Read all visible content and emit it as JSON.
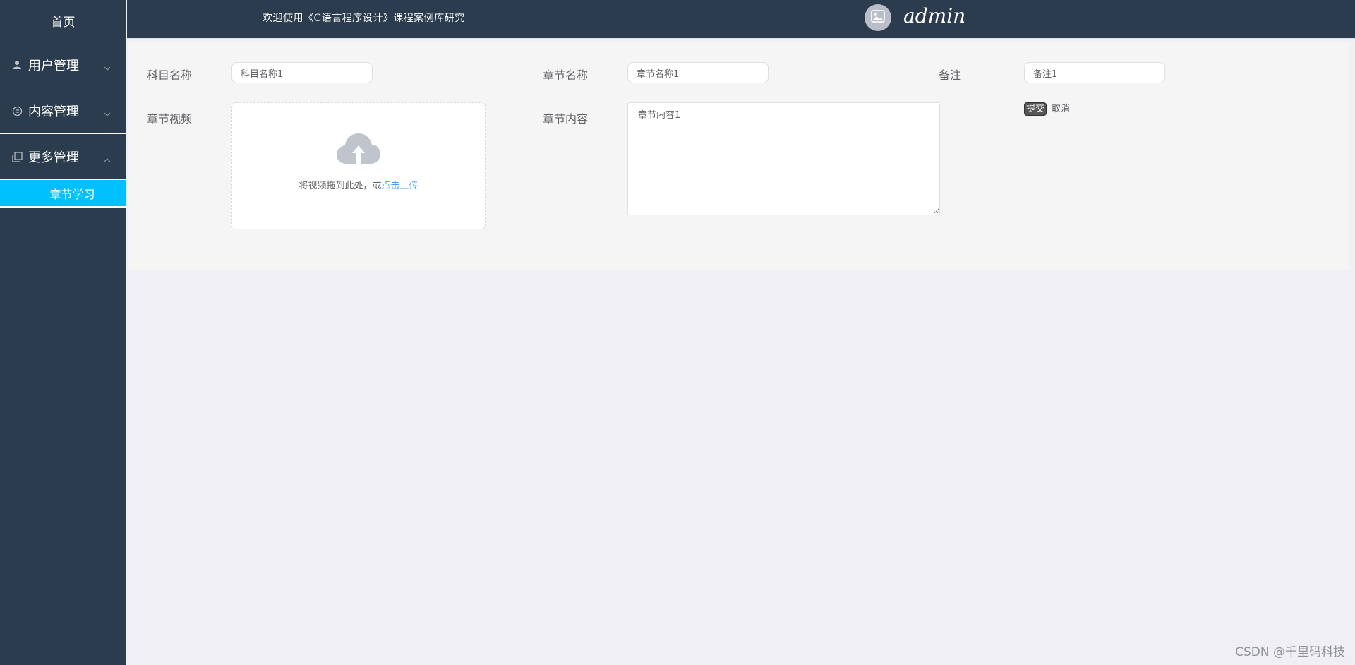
{
  "sidebar": {
    "home": "首页",
    "groups": [
      {
        "label": "用户管理",
        "icon": "user-icon"
      },
      {
        "label": "内容管理",
        "icon": "chat-icon"
      },
      {
        "label": "更多管理",
        "icon": "copy-icon"
      }
    ],
    "active_sub": "章节学习"
  },
  "header": {
    "welcome": "欢迎使用《C语言程序设计》课程案例库研究",
    "username": "admin"
  },
  "form": {
    "subject_label": "科目名称",
    "subject_value": "科目名称1",
    "chapter_name_label": "章节名称",
    "chapter_name_value": "章节名称1",
    "remark_label": "备注",
    "remark_value": "备注1",
    "video_label": "章节视频",
    "upload_text": "将视频拖到此处，或",
    "upload_link": "点击上传",
    "content_label": "章节内容",
    "content_value": "章节内容1",
    "submit": "提交",
    "cancel": "取消"
  },
  "watermark": "CSDN @千里码科技"
}
